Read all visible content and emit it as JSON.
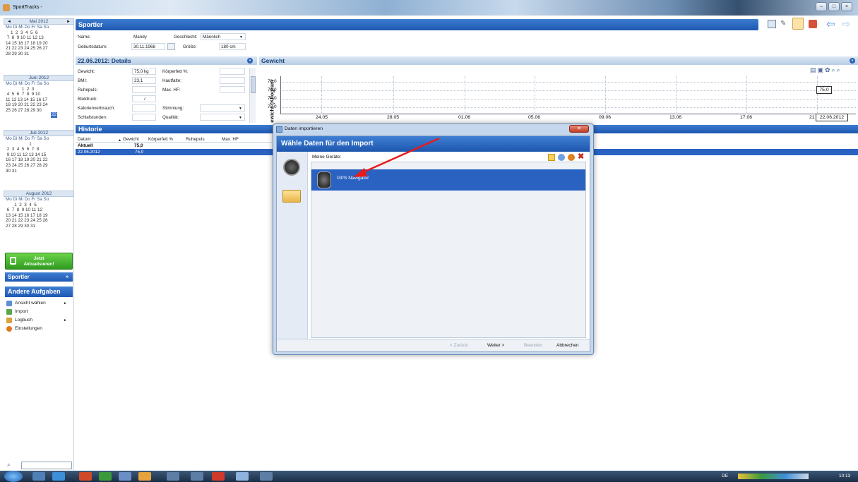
{
  "window": {
    "title": "SportTracks -"
  },
  "calendars": [
    {
      "month": "Mai 2012",
      "rows": [
        "Mo Di Mi Do Fr Sa So",
        "    1  2  3  4  5  6",
        " 7  8  9 10 11 12 13",
        "14 15 16 17 18 19 20",
        "21 22 23 24 25 26 27",
        "28 29 30 31"
      ]
    },
    {
      "month": "Juni 2012",
      "rows": [
        "Mo Di Mi Do Fr Sa So",
        "             1  2  3",
        " 4  5  6  7  8  9 10",
        "11 12 13 14 15 16 17",
        "18 19 20 21 22 23 24",
        "25 26 27 28 29 30"
      ]
    },
    {
      "month": "Juli 2012",
      "rows": [
        "Mo Di Mi Do Fr Sa So",
        "                   1",
        " 2  3  4  5  6  7  8",
        " 9 10 11 12 13 14 15",
        "16 17 18 19 20 21 22",
        "23 24 25 26 27 28 29",
        "30 31"
      ]
    },
    {
      "month": "August 2012",
      "rows": [
        "Mo Di Mi Do Fr Sa So",
        "       1  2  3  4  5",
        " 6  7  8  9 10 11 12",
        "13 14 15 16 17 18 19",
        "20 21 22 23 24 25 26",
        "27 28 29 30 31"
      ]
    }
  ],
  "left_panel": {
    "update_button": {
      "line1": "Jetzt",
      "line2": "Aktualisieren!"
    },
    "sportler_panel": "Sportler",
    "tasks_title": "Andere Aufgaben",
    "tasks": [
      "Ansicht wählen",
      "Import",
      "Logbuch",
      "Einstellungen"
    ]
  },
  "sportler": {
    "title": "Sportler",
    "name_label": "Name:",
    "name_value": "Mandy",
    "gender_label": "Geschlecht:",
    "gender_value": "Männlich",
    "birth_label": "Geburtsdatum:",
    "birth_value": "30.11.1968",
    "height_label": "Größe:",
    "height_value": "180 cm"
  },
  "details": {
    "title": "22.06.2012: Details",
    "rows": [
      {
        "label": "Gewicht:",
        "value": "75,0 kg",
        "label2": "Körperfett %:"
      },
      {
        "label": "BMI:",
        "value": "23,1",
        "label2": "Hautfalte:"
      },
      {
        "label": "Ruhepuls:",
        "value": "",
        "label2": "Max. HF:"
      },
      {
        "label": "Blutdruck:",
        "value": "/",
        "label2": ""
      },
      {
        "label": "Kalorienverbrauch:",
        "value": "",
        "label2": "Stimmung:"
      },
      {
        "label": "Schlafstunden:",
        "value": "",
        "label2": "Qualität:"
      }
    ]
  },
  "gewicht": {
    "title": "Gewicht",
    "ylabel": "ewicht (Kilogram",
    "yticks": [
      "78,0",
      "76,0",
      "74,0",
      "72,0"
    ],
    "xticks": [
      "24.05",
      "28.05",
      "01.06",
      "05.06",
      "09.06",
      "13.06",
      "17.06",
      "21"
    ],
    "value_label": "75,0",
    "date_label": "22.06.2012"
  },
  "historie": {
    "title": "Historie",
    "columns": [
      "Datum",
      "Gewicht",
      "Körperfett %",
      "Ruhepuls",
      "Max. HF"
    ],
    "current_label": "Aktuell",
    "current_value": "75,0",
    "rows": [
      {
        "date": "22.06.2012",
        "weight": "75,0"
      }
    ]
  },
  "dialog": {
    "title": "Daten importieren",
    "header": "Wähle Daten für den Import",
    "devices_label": "Meine Geräte:",
    "device_name": "GPS Navigator",
    "back": "< Zurück",
    "next": "Weiter >",
    "finish": "Beenden",
    "cancel": "Abbrechen"
  },
  "taskbar": {
    "lang": "DE",
    "time": "10:13"
  }
}
